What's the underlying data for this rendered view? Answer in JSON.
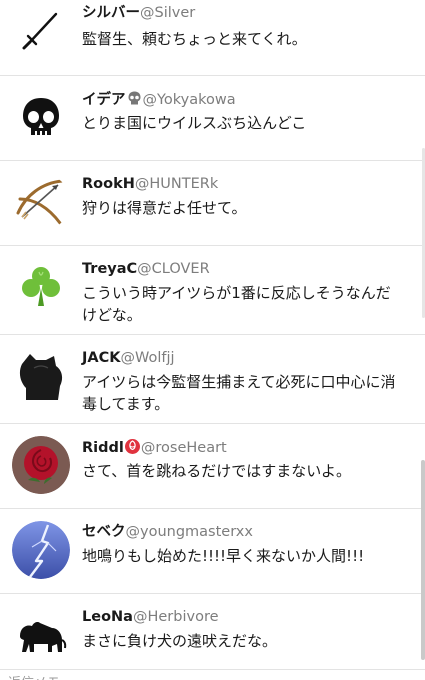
{
  "posts": [
    {
      "name": "シルバー",
      "handle": "@Silver",
      "text": "監督生、頼むちょっと来てくれ。",
      "avatar_icon": "sword-icon"
    },
    {
      "name": "イデア",
      "handle": "@Yokyakowa",
      "text": "とりま国にウイルスぶち込んどこ",
      "avatar_icon": "skull-icon",
      "name_emoji": "skull-emoji"
    },
    {
      "name": "RookH",
      "handle": "@HUNTERk",
      "text": "狩りは得意だよ任せて。",
      "avatar_icon": "bow-arrow-icon"
    },
    {
      "name": "TreyaC",
      "handle": "@CLOVER",
      "text": "こういう時アイツらが1番に反応しそうなんだけどな。",
      "avatar_icon": "clover-icon"
    },
    {
      "name": "JACK",
      "handle": "@Wolfjj",
      "text": "アイツらは今監督生捕まえて必死に口中心に消毒してます。",
      "avatar_icon": "wolf-silhouette-icon"
    },
    {
      "name": "Riddl",
      "handle": "@roseHeart",
      "text": "さて、首を跳ねるだけではすまないよ。",
      "avatar_icon": "rose-icon",
      "name_emoji": "rose-emoji"
    },
    {
      "name": "セベク",
      "handle": "@youngmasterxx",
      "text": "地鳴りもし始めた!!!!早く来ないか人間!!!",
      "avatar_icon": "lightning-icon"
    },
    {
      "name": "LeoNa",
      "handle": "@Herbivore",
      "text": "まさに負け犬の遠吠えだな。",
      "avatar_icon": "lion-icon"
    }
  ],
  "footer": {
    "text": "返信メモ"
  },
  "colors": {
    "name": "#1a1a1a",
    "handle": "#7d7d7d",
    "divider": "#e3e3e3",
    "rose": "#b3122a",
    "clover": "#6fbf3a",
    "lightning_bg": "#4a5fb8"
  }
}
